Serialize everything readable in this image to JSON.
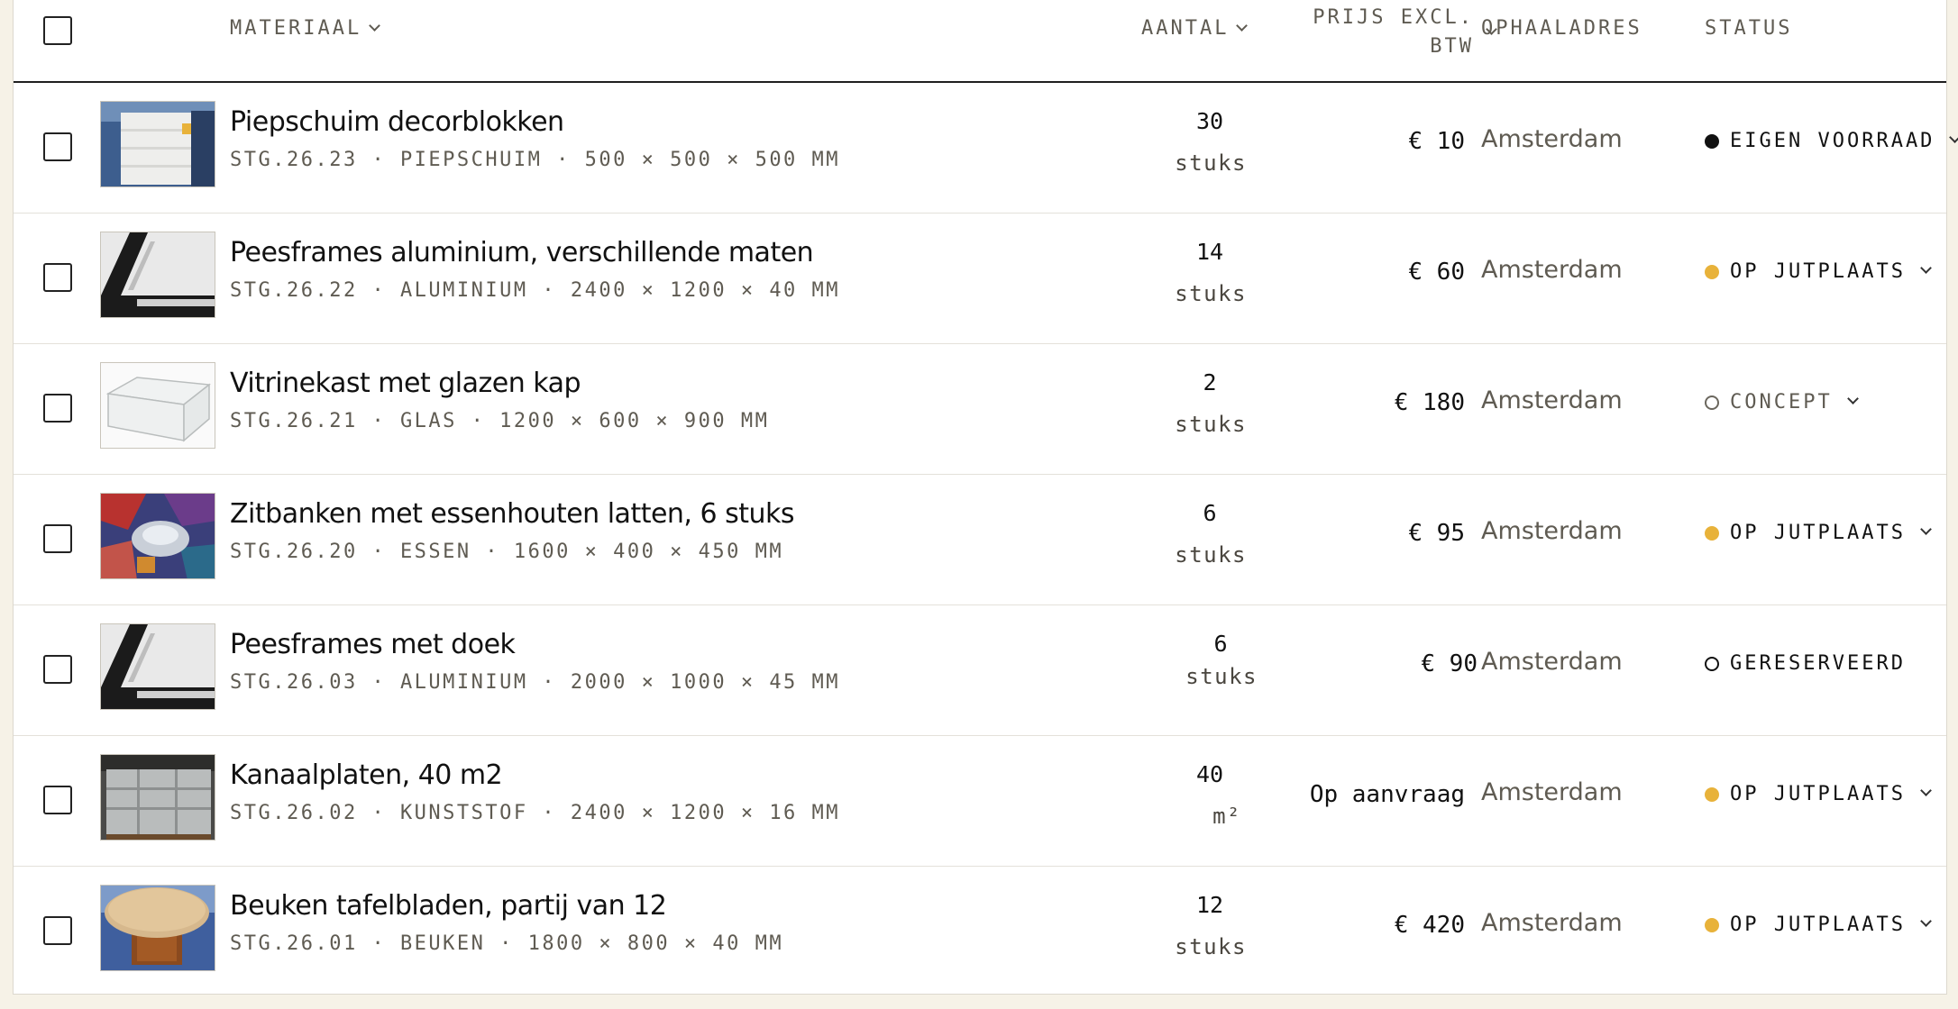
{
  "header": {
    "material": "MATERIAAL",
    "quantity": "AANTAL",
    "price_line1": "PRIJS EXCL.",
    "price_line2": "BTW",
    "address": "OPHAALADRES",
    "status": "STATUS"
  },
  "rows": [
    {
      "title": "Piepschuim decorblokken",
      "meta": "STG.26.23 · PIEPSCHUIM · 500 × 500 × 500 MM",
      "qty": "30",
      "unit": "stuks",
      "price": "€ 10",
      "city": "Amsterdam",
      "status": "EIGEN VOORRAAD",
      "status_color": "#111111",
      "image": "white-foam-blocks"
    },
    {
      "title": "Peesframes aluminium, verschillende maten",
      "meta": "STG.26.22 · ALUMINIUM · 2400 × 1200 × 40 MM",
      "qty": "14",
      "unit": "stuks",
      "price": "€ 60",
      "city": "Amsterdam",
      "status": "OP JUTPLAATS",
      "status_color": "#e8b23a",
      "image": "aluminium-frame"
    },
    {
      "title": "Vitrinekast met glazen kap",
      "meta": "STG.26.21 · GLAS · 1200 × 600 × 900 MM",
      "qty": "2",
      "unit": "stuks",
      "price": "€ 180",
      "city": "Amsterdam",
      "status": "CONCEPT",
      "status_color": "#6b675e",
      "image": "glass-display-case"
    },
    {
      "title": "Zitbanken met essenhouten latten, 6 stuks",
      "meta": "STG.26.20 · ESSEN · 1600 × 400 × 450 MM",
      "qty": "6",
      "unit": "stuks",
      "price": "€ 95",
      "city": "Amsterdam",
      "status": "OP JUTPLAATS",
      "status_color": "#e8b23a",
      "image": "colorful-installation"
    },
    {
      "title": "Peesframes met doek",
      "meta": "STG.26.03 · ALUMINIUM · 2000 × 1000 × 45 MM",
      "qty": "6",
      "unit": "stuks",
      "price": "€ 90",
      "city": "Amsterdam",
      "status": "GERESERVEERD",
      "status_color": "#111111",
      "image": "aluminium-frame"
    },
    {
      "title": "Kanaalplaten, 40 m2",
      "meta": "STG.26.02 · KUNSTSTOF · 2400 × 1200 × 16 MM",
      "qty": "40",
      "unit": "m²",
      "price": "Op aanvraag",
      "city": "Amsterdam",
      "status": "OP JUTPLAATS",
      "status_color": "#e8b23a",
      "image": "stacked-panels"
    },
    {
      "title": "Beuken tafelbladen, partij van 12",
      "meta": "STG.26.01 · BEUKEN · 1800 × 800 × 40 MM",
      "qty": "12",
      "unit": "stuks",
      "price": "€ 420",
      "city": "Amsterdam",
      "status": "OP JUTPLAATS",
      "status_color": "#e8b23a",
      "image": "round-wooden-table"
    }
  ]
}
